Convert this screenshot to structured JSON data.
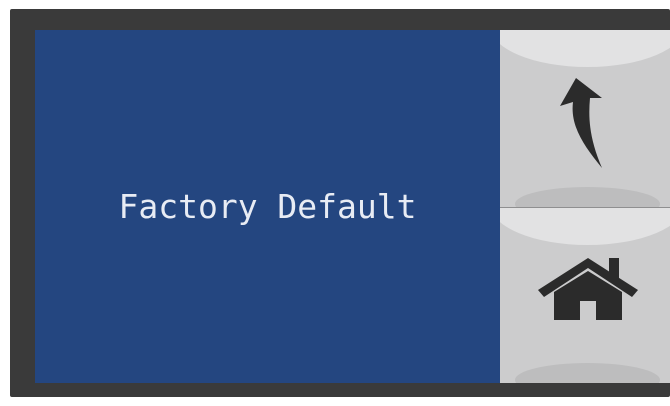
{
  "screen": {
    "title": "Factory Default"
  },
  "sidebar": {
    "buttons": [
      {
        "icon": "back-icon"
      },
      {
        "icon": "home-icon"
      }
    ]
  },
  "colors": {
    "panel": "#244680",
    "text": "#e8ecf4",
    "bezel": "#3a3a3a",
    "button": "#cccccd",
    "icon": "#2b2b2b"
  }
}
